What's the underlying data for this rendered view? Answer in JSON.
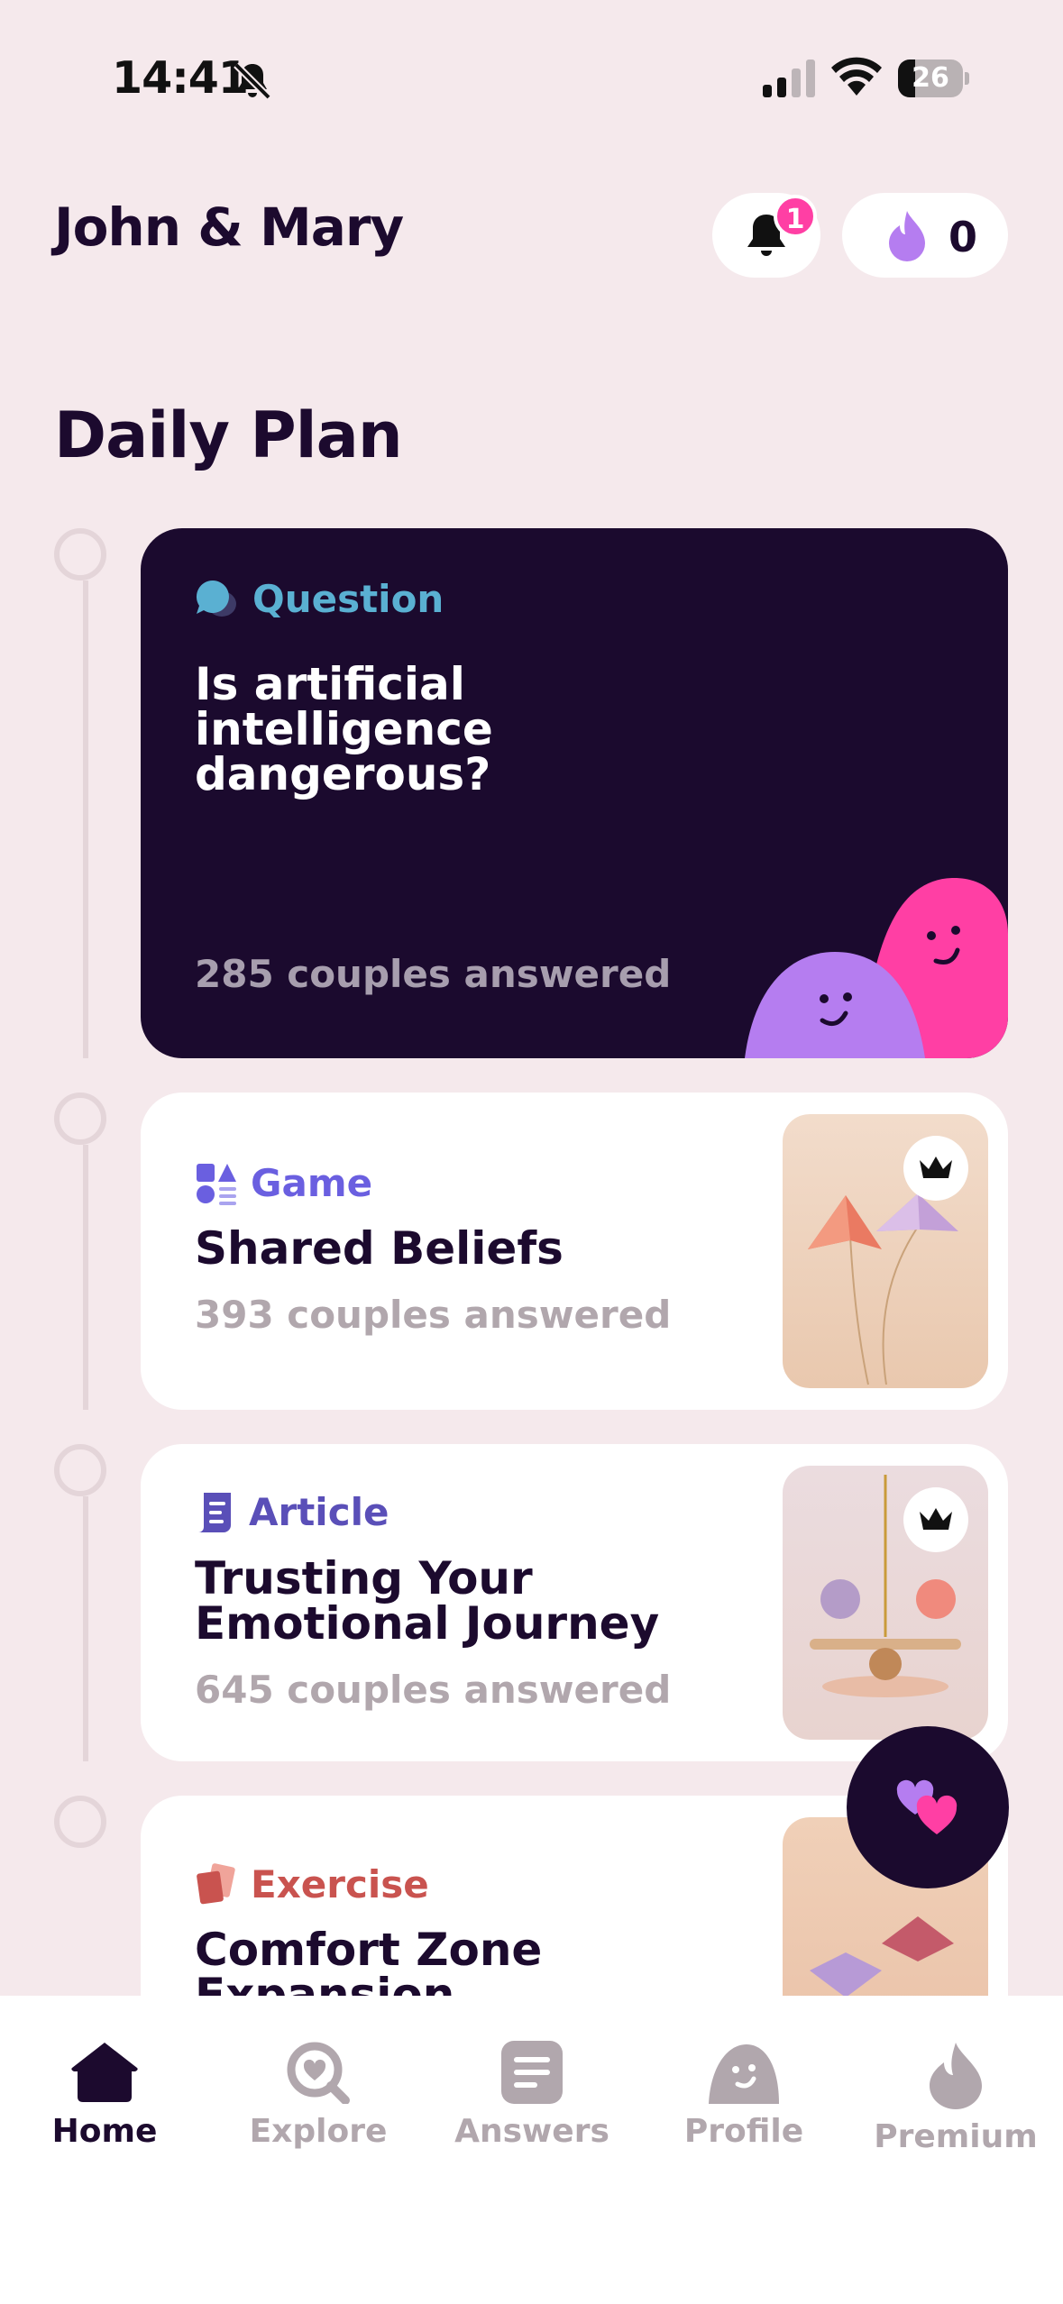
{
  "status_bar": {
    "time": "14:41",
    "battery": "26"
  },
  "header": {
    "couple_name": "John & Mary",
    "notification_count": "1",
    "flame_count": "0"
  },
  "section_title": "Daily Plan",
  "cards": [
    {
      "type": "Question",
      "title": "Is artificial intelligence dangerous?",
      "count": "285 couples answered",
      "type_color": "#5ab0d2"
    },
    {
      "type": "Game",
      "title": "Shared Beliefs",
      "count": "393 couples answered",
      "type_color": "#6a5fe0",
      "premium": true
    },
    {
      "type": "Article",
      "title": "Trusting Your Emotional Journey",
      "count": "645 couples answered",
      "type_color": "#5a4fb8",
      "premium": true
    },
    {
      "type": "Exercise",
      "title": "Comfort Zone Expansion",
      "type_color": "#c9534f"
    }
  ],
  "tabs": [
    {
      "label": "Home",
      "icon": "home-icon",
      "active": true
    },
    {
      "label": "Explore",
      "icon": "explore-icon"
    },
    {
      "label": "Answers",
      "icon": "answers-icon"
    },
    {
      "label": "Profile",
      "icon": "profile-icon"
    },
    {
      "label": "Premium",
      "icon": "premium-icon"
    }
  ],
  "colors": {
    "background": "#f5e9ec",
    "dark": "#1b0a2e",
    "accent_pink": "#ff3fa4",
    "accent_purple": "#b57df0"
  }
}
